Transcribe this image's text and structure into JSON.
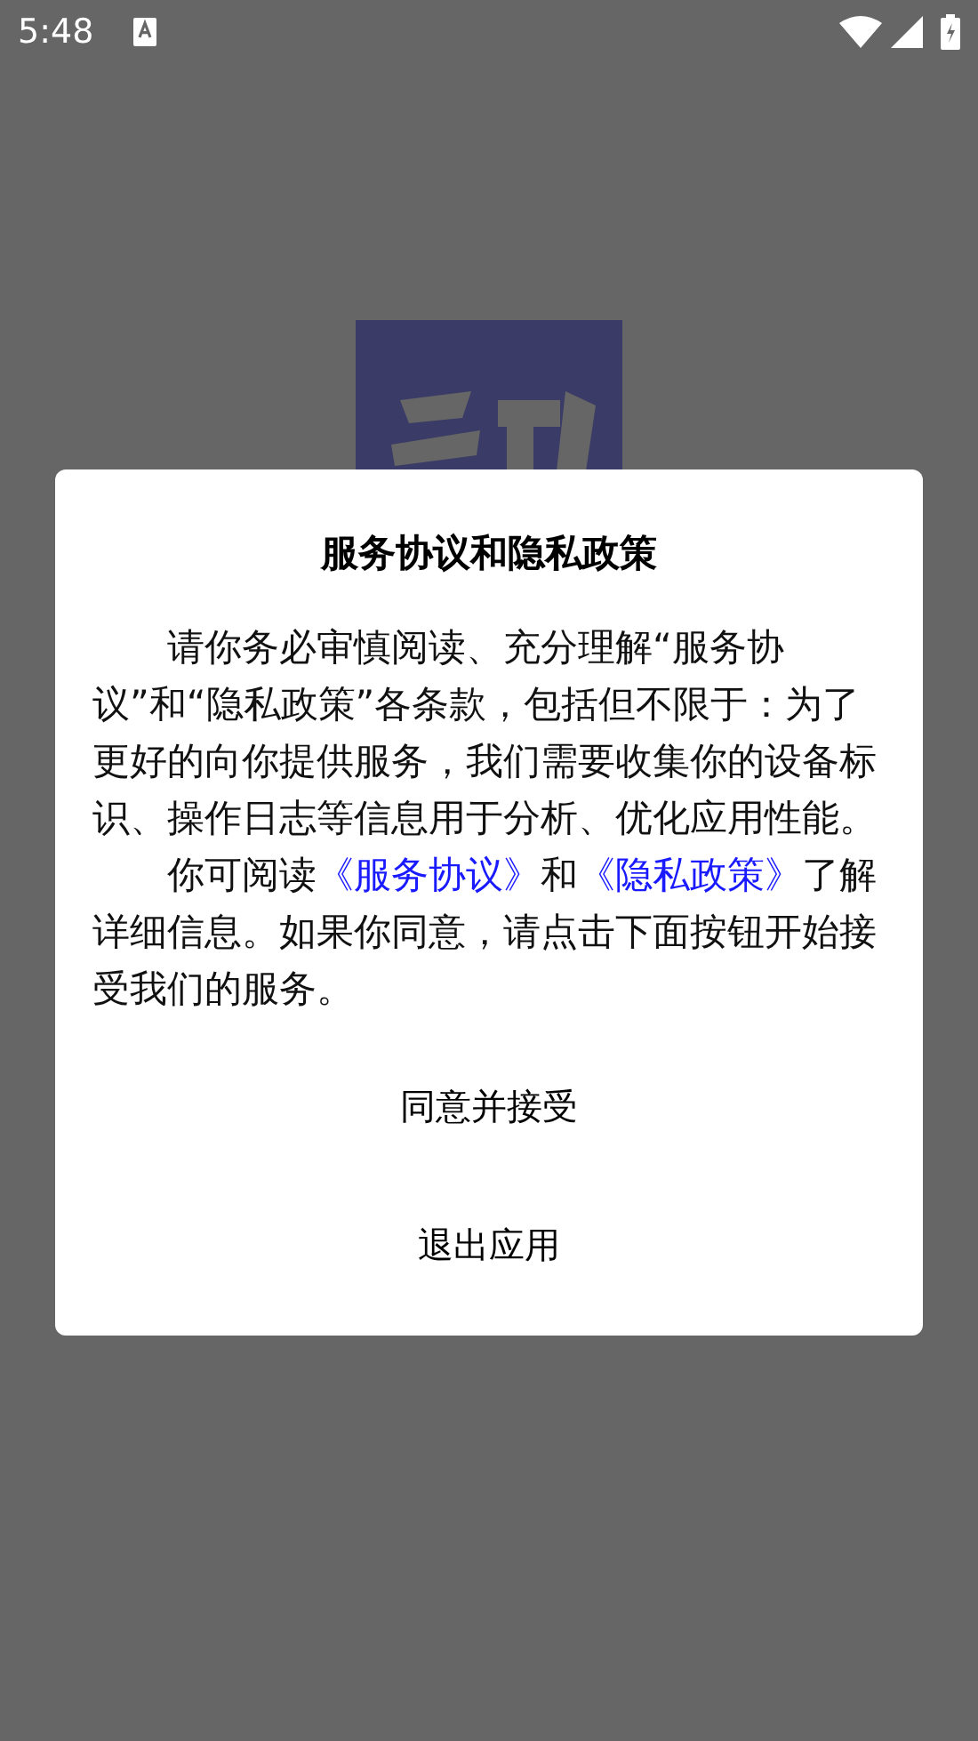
{
  "status_bar": {
    "time": "5:48"
  },
  "dialog": {
    "title": "服务协议和隐私政策",
    "paragraphs": [
      {
        "parts": [
          {
            "kind": "text",
            "text": "请你务必审慎阅读、充分理解“服务协议”和“隐私政策”各条款，包括但不限于：为了更好的向你提供服务，我们需要收集你的设备标识、操作日志等信息用于分析、优化应用性能。"
          }
        ]
      },
      {
        "parts": [
          {
            "kind": "text",
            "text": "你可阅读"
          },
          {
            "kind": "link",
            "text": "《服务协议》"
          },
          {
            "kind": "text",
            "text": "和"
          },
          {
            "kind": "link",
            "text": "《隐私政策》"
          },
          {
            "kind": "text",
            "text": "了解详细信息。如果你同意，请点击下面按钮开始接受我们的服务。"
          }
        ]
      }
    ],
    "buttons": [
      "同意并接受",
      "退出应用"
    ]
  }
}
